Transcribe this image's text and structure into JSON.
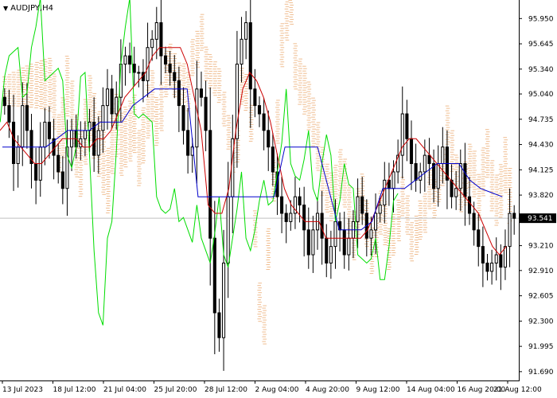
{
  "window": {
    "title": "AUDJPY,H4",
    "menu_icon": "triangle-down-icon"
  },
  "price_axis": {
    "ticks": [
      "95.950",
      "95.645",
      "95.340",
      "95.040",
      "94.735",
      "94.430",
      "94.125",
      "93.820",
      "93.520",
      "93.210",
      "92.910",
      "92.605",
      "92.300",
      "91.995",
      "91.690"
    ],
    "current_price": "93.541",
    "current_price_value": 93.541
  },
  "time_axis": {
    "labels": [
      "13 Jul 2023",
      "18 Jul 12:00",
      "21 Jul 04:00",
      "25 Jul 20:00",
      "28 Jul 12:00",
      "2 Aug 04:00",
      "4 Aug 20:00",
      "9 Aug 12:00",
      "14 Aug 04:00",
      "16 Aug 20:00",
      "21 Aug 12:00"
    ]
  },
  "colors": {
    "candle": "#000000",
    "tenkan_sen": "#cc0000",
    "kijun_sen": "#0000cc",
    "chikou_span": "#00dd00",
    "cloud_bull": "#e8a060",
    "cloud_bear": "#d8a0c0",
    "price_line": "#c0c0c0"
  },
  "chart_data": {
    "type": "candlestick",
    "symbol": "AUDJPY",
    "timeframe": "H4",
    "ylim": [
      91.66,
      96.02
    ],
    "grid": false,
    "indicator": "Ichimoku Kinko Hyo",
    "close_series": [
      94.9,
      94.7,
      94.2,
      94.4,
      94.9,
      94.6,
      94.2,
      94.0,
      94.4,
      94.7,
      94.5,
      94.3,
      94.1,
      93.9,
      94.4,
      94.6,
      94.4,
      94.5,
      94.6,
      94.7,
      94.3,
      94.6,
      94.9,
      95.1,
      94.8,
      95.0,
      95.4,
      95.5,
      95.4,
      95.3,
      95.3,
      95.2,
      95.6,
      95.7,
      95.9,
      95.5,
      95.4,
      95.3,
      95.2,
      94.9,
      94.6,
      94.3,
      94.4,
      95.1,
      95.0,
      94.6,
      93.3,
      92.4,
      92.1,
      93.0,
      93.8,
      94.5,
      95.4,
      95.7,
      95.9,
      95.1,
      94.9,
      94.8,
      94.6,
      94.4,
      94.1,
      93.8,
      93.6,
      93.5,
      93.6,
      93.8,
      93.7,
      93.4,
      93.1,
      93.4,
      93.6,
      93.3,
      93.0,
      93.2,
      93.5,
      93.4,
      93.1,
      93.3,
      93.5,
      93.8,
      93.6,
      93.3,
      93.4,
      93.6,
      93.7,
      94.0,
      93.9,
      94.1,
      94.3,
      94.8,
      94.5,
      94.2,
      94.0,
      94.1,
      94.3,
      94.2,
      93.9,
      94.2,
      94.4,
      94.0,
      93.8,
      93.9,
      94.2,
      93.8,
      93.6,
      93.4,
      93.2,
      93.0,
      92.9,
      93.0,
      93.1,
      92.95,
      93.2,
      93.6,
      93.54
    ],
    "tenkan_sen": [
      94.6,
      94.7,
      94.5,
      94.4,
      94.3,
      94.2,
      94.2,
      94.3,
      94.4,
      94.5,
      94.5,
      94.5,
      94.4,
      94.4,
      94.5,
      94.5,
      94.6,
      94.8,
      95.0,
      95.1,
      95.2,
      95.3,
      95.5,
      95.6,
      95.6,
      95.6,
      95.6,
      95.4,
      95.0,
      94.6,
      93.7,
      93.6,
      93.6,
      93.9,
      94.6,
      95.1,
      95.3,
      95.2,
      95.0,
      94.7,
      94.3,
      93.9,
      93.7,
      93.6,
      93.5,
      93.5,
      93.5,
      93.3,
      93.3,
      93.3,
      93.3,
      93.3,
      93.3,
      93.4,
      93.6,
      93.8,
      94.0,
      94.2,
      94.4,
      94.5,
      94.5,
      94.4,
      94.3,
      94.2,
      94.1,
      94.0,
      93.9,
      93.8,
      93.7,
      93.6,
      93.4,
      93.2,
      93.1,
      93.2
    ],
    "kijun_sen": [
      94.4,
      94.4,
      94.4,
      94.4,
      94.4,
      94.5,
      94.6,
      94.6,
      94.6,
      94.7,
      94.7,
      94.7,
      94.9,
      95.0,
      95.1,
      95.1,
      95.1,
      95.1,
      93.8,
      93.8,
      93.8,
      93.8,
      93.8,
      93.8,
      93.8,
      93.8,
      94.4,
      94.4,
      94.4,
      94.4,
      93.9,
      93.4,
      93.4,
      93.4,
      93.5,
      93.9,
      93.9,
      93.9,
      94.0,
      94.1,
      94.2,
      94.2,
      94.2,
      94.0,
      93.9,
      93.85,
      93.8
    ]
  }
}
